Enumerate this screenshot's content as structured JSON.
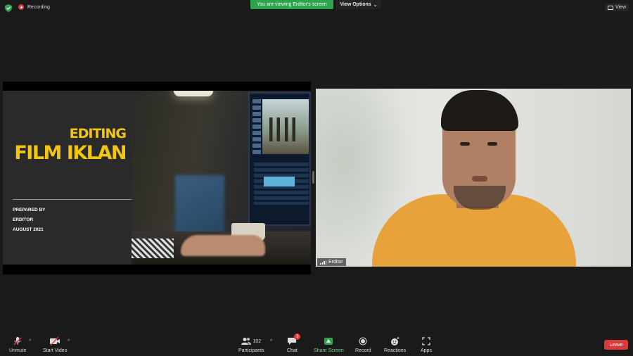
{
  "top_bar": {
    "recording_label": "Recording",
    "viewing_banner": "You are viewing Erditor's screen",
    "view_options_label": "View Options",
    "view_label": "View"
  },
  "slide": {
    "title_line1": "EDITING",
    "title_line2": "FILM IKLAN",
    "prepared_by": "PREPARED BY",
    "author": "ERDITOR",
    "date": "AUGUST 2021"
  },
  "video": {
    "participant_name": "Erditor"
  },
  "toolbar": {
    "unmute": "Unmute",
    "start_video": "Start Video",
    "participants": "Participants",
    "participants_count": "102",
    "chat": "Chat",
    "chat_badge": "3",
    "share_screen": "Share Screen",
    "record": "Record",
    "reactions": "Reactions",
    "apps": "Apps",
    "leave": "Leave"
  },
  "colors": {
    "accent_green": "#2ea44f",
    "slide_yellow": "#f2c513",
    "leave_red": "#d93b3b",
    "shirt": "#e8a23b"
  }
}
